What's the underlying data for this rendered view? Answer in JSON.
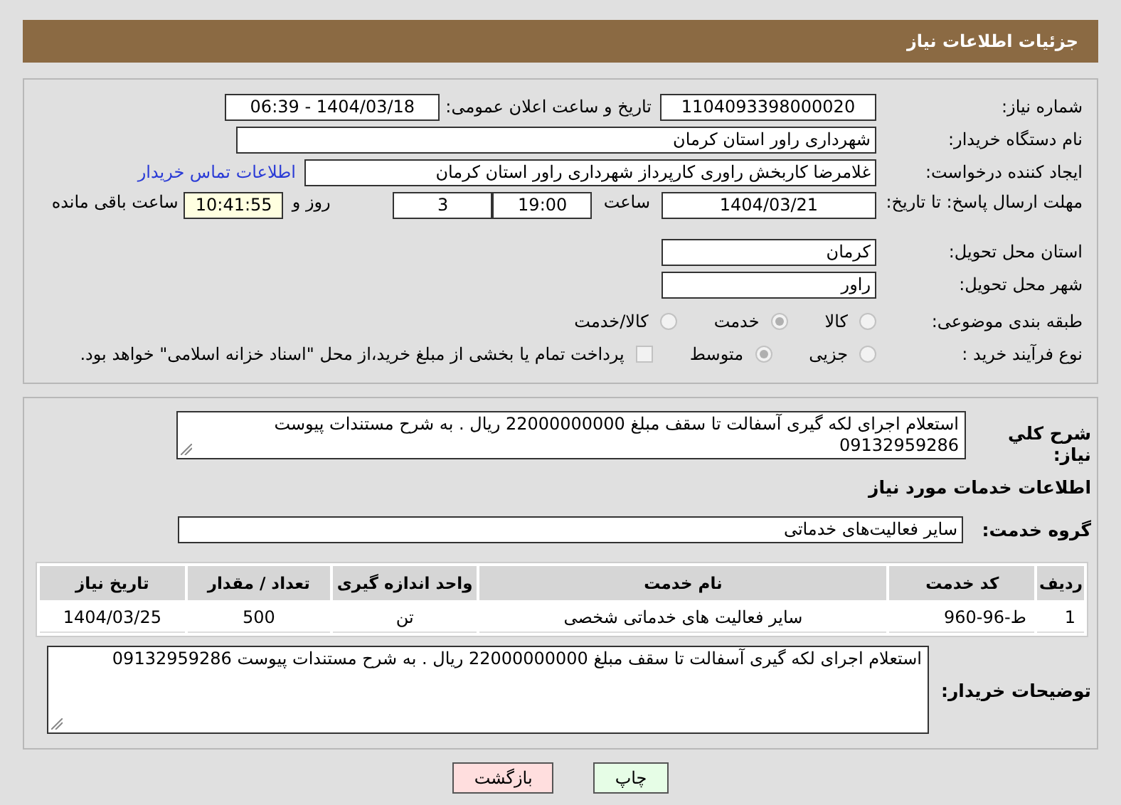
{
  "header": {
    "title": "جزئیات اطلاعات نیاز"
  },
  "need_number": {
    "label": "شماره نیاز:",
    "value": "1104093398000020"
  },
  "announce": {
    "label": "تاریخ و ساعت اعلان عمومی:",
    "value": "1404/03/18 - 06:39"
  },
  "buyer_org": {
    "label": "نام دستگاه خریدار:",
    "value": "شهرداری راور استان کرمان"
  },
  "creator": {
    "label": "ایجاد کننده درخواست:",
    "value": "غلامرضا کاربخش راوری کارپرداز  شهرداری راور استان کرمان",
    "link": "اطلاعات تماس خریدار"
  },
  "deadline": {
    "label": "مهلت ارسال پاسخ: تا تاریخ:",
    "date": "1404/03/21",
    "time_label": "ساعت",
    "time": "19:00",
    "days": "3",
    "days_label": "روز و",
    "remaining": "10:41:55",
    "remaining_label": "ساعت باقی مانده"
  },
  "province": {
    "label": "استان محل تحویل:",
    "value": "کرمان"
  },
  "city": {
    "label": "شهر محل تحویل:",
    "value": "راور"
  },
  "category": {
    "label": "طبقه بندی موضوعی:",
    "options": [
      {
        "label": "کالا",
        "selected": false
      },
      {
        "label": "خدمت",
        "selected": true
      },
      {
        "label": "کالا/خدمت",
        "selected": false
      }
    ]
  },
  "process": {
    "label": "نوع فرآیند خرید :",
    "options": [
      {
        "label": "جزیی",
        "selected": false
      },
      {
        "label": "متوسط",
        "selected": true
      }
    ],
    "payment": {
      "checked": false,
      "label": "پرداخت تمام یا بخشی از مبلغ خرید،از محل \"اسناد خزانه اسلامی\" خواهد بود."
    }
  },
  "description": {
    "label": "شرح کلي نياز:",
    "value": "استعلام اجرای لکه گیری آسفالت تا سقف مبلغ 22000000000 ریال . به شرح مستندات پیوست 09132959286"
  },
  "services_heading": "اطلاعات خدمات مورد نیاز",
  "service_group": {
    "label": "گروه خدمت:",
    "value": "سایر فعالیت‌های خدماتی"
  },
  "table": {
    "columns": [
      "ردیف",
      "کد خدمت",
      "نام خدمت",
      "واحد اندازه گیری",
      "تعداد / مقدار",
      "تاریخ نیاز"
    ],
    "rows": [
      [
        "1",
        "ط-96-960",
        "سایر فعالیت های خدماتی شخصی",
        "تن",
        "500",
        "1404/03/25"
      ]
    ]
  },
  "buyer_notes": {
    "label": "توضیحات خریدار:",
    "value": "استعلام اجرای لکه گیری آسفالت تا سقف مبلغ 22000000000 ریال . به شرح مستندات پیوست 09132959286"
  },
  "buttons": [
    {
      "label": "چاپ",
      "kind": "print"
    },
    {
      "label": "بازگشت",
      "kind": "back"
    }
  ]
}
